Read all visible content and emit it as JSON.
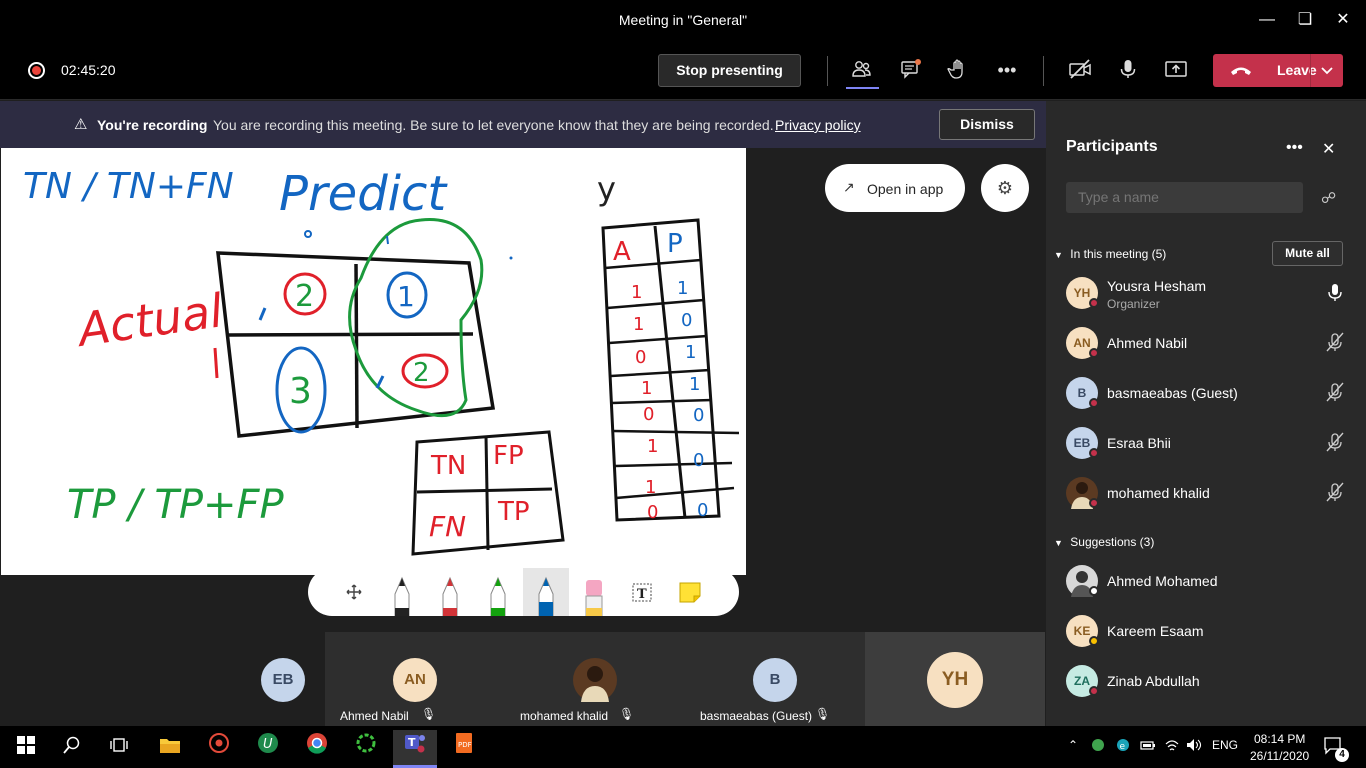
{
  "window": {
    "title": "Meeting in \"General\""
  },
  "toolbar": {
    "timer": "02:45:20",
    "stop_presenting_label": "Stop presenting",
    "leave_label": "Leave"
  },
  "banner": {
    "bold": "You're recording",
    "text": "You are recording this meeting. Be sure to let everyone know that they are being recorded.",
    "link": "Privacy policy",
    "dismiss_label": "Dismiss"
  },
  "stage": {
    "open_in_app_label": "Open in app",
    "whiteboard": {
      "formula_1": "TN / TN+FN",
      "predict": "Predict",
      "actual": "Actual",
      "formula_2": "TP / TP+FP",
      "y_label": "y",
      "matrix": {
        "c1": "2",
        "c2": "1",
        "c3": "3",
        "c4": "2"
      },
      "small_matrix": [
        "TN",
        "FP",
        "FN",
        "TP"
      ],
      "table_head": [
        "A",
        "P"
      ],
      "table_a": [
        "1",
        "1",
        "0",
        "1",
        "0",
        "1",
        "1",
        "0"
      ],
      "table_p": [
        "1",
        "0",
        "1",
        "1",
        "0",
        "",
        "0",
        "0"
      ]
    }
  },
  "strip": {
    "tiles": [
      {
        "initials": "EB",
        "name": ""
      },
      {
        "initials": "AN",
        "name": "Ahmed Nabil"
      },
      {
        "initials": "",
        "name": "mohamed khalid"
      },
      {
        "initials": "B",
        "name": "basmaeabas (Guest)"
      },
      {
        "initials": "YH",
        "name": ""
      }
    ]
  },
  "panel": {
    "title": "Participants",
    "search_placeholder": "Type a name",
    "in_meeting_label": "In this meeting (5)",
    "mute_all_label": "Mute all",
    "participants": [
      {
        "initials": "YH",
        "name": "Yousra Hesham",
        "role": "Organizer"
      },
      {
        "initials": "AN",
        "name": "Ahmed Nabil",
        "role": ""
      },
      {
        "initials": "B",
        "name": "basmaeabas (Guest)",
        "role": ""
      },
      {
        "initials": "EB",
        "name": "Esraa Bhii",
        "role": ""
      },
      {
        "initials": "",
        "name": "mohamed khalid",
        "role": ""
      }
    ],
    "suggestions_label": "Suggestions (3)",
    "suggestions": [
      {
        "initials": "",
        "name": "Ahmed Mohamed"
      },
      {
        "initials": "KE",
        "name": "Kareem Esaam"
      },
      {
        "initials": "ZA",
        "name": "Zinab Abdullah"
      }
    ]
  },
  "taskbar": {
    "lang": "ENG",
    "time": "08:14 PM",
    "date": "26/11/2020",
    "notifications": "4"
  },
  "colors": {
    "leave": "#c4314b",
    "banner": "#2d2c42",
    "accent": "#6264a7"
  }
}
